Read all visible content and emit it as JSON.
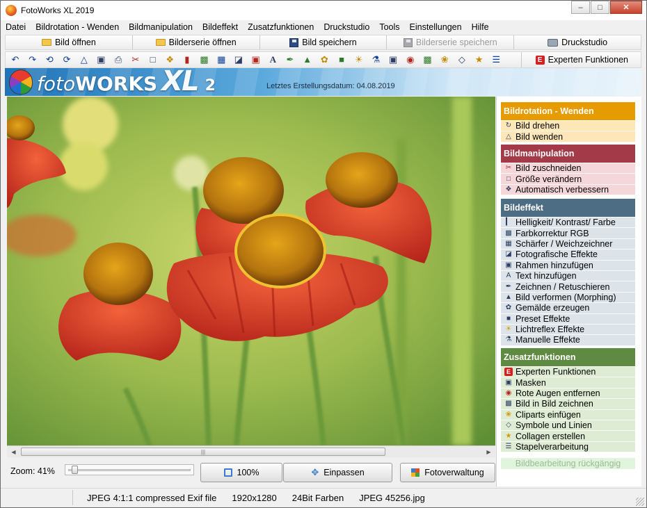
{
  "window": {
    "title": "FotoWorks XL 2019"
  },
  "menu": [
    "Datei",
    "Bildrotation - Wenden",
    "Bildmanipulation",
    "Bildeffekt",
    "Zusatzfunktionen",
    "Druckstudio",
    "Tools",
    "Einstellungen",
    "Hilfe"
  ],
  "actions": {
    "open": "Bild öffnen",
    "open_series": "Bilderserie öffnen",
    "save": "Bild speichern",
    "save_series": "Bilderserie speichern",
    "print_studio": "Druckstudio"
  },
  "toolbar": {
    "icons": [
      "rotate-left-icon",
      "rotate-right-icon",
      "rotate-ccw-icon",
      "rotate-cw-icon",
      "flip-icon",
      "box-icon",
      "printer-icon",
      "scissors-icon",
      "crop-icon",
      "magic-wand-icon",
      "levels-icon",
      "rgb-icon",
      "sharpen-icon",
      "effects-icon",
      "frame-icon",
      "text-icon",
      "brush-icon",
      "morph-icon",
      "paint-icon",
      "preset-icon",
      "light-icon",
      "manual-icon",
      "mask-icon",
      "red-eye-icon",
      "picture-in-picture-icon",
      "clipart-icon",
      "shapes-icon",
      "star-icon",
      "batch-icon"
    ],
    "expert_label": "Experten Funktionen",
    "expert_badge": "E"
  },
  "banner": {
    "logo_foto": "foto",
    "logo_works": "WORKS",
    "logo_xl": "XL",
    "logo_version": "2",
    "build_date": "Letztes Erstellungsdatum: 04.08.2019"
  },
  "bottom": {
    "zoom_label": "Zoom: 41%",
    "zoom_value": 0.05,
    "btn_100": "100%",
    "btn_fit": "Einpassen",
    "btn_manage": "Fotoverwaltung"
  },
  "sidebar": {
    "sections": [
      {
        "title": "Bildrotation - Wenden",
        "color": "#e69c00",
        "bg": "#fde7b8",
        "items": [
          {
            "label": "Bild drehen",
            "icon": "rotate-icon"
          },
          {
            "label": "Bild wenden",
            "icon": "flip-icon"
          }
        ]
      },
      {
        "title": "Bildmanipulation",
        "color": "#a33a48",
        "bg": "#f5d6d9",
        "items": [
          {
            "label": "Bild zuschneiden",
            "icon": "scissors-icon"
          },
          {
            "label": "Größe verändern",
            "icon": "resize-icon"
          },
          {
            "label": "Automatisch verbessern",
            "icon": "magic-wand-icon"
          }
        ]
      },
      {
        "title": "Bildeffekt",
        "color": "#4c6d84",
        "bg": "#dce4ea",
        "items": [
          {
            "label": "Helligkeit/ Kontrast/ Farbe",
            "icon": "levels-icon"
          },
          {
            "label": "Farbkorrektur RGB",
            "icon": "rgb-icon"
          },
          {
            "label": "Schärfer / Weichzeichner",
            "icon": "sharpen-icon"
          },
          {
            "label": "Fotografische Effekte",
            "icon": "photo-effects-icon"
          },
          {
            "label": "Rahmen hinzufügen",
            "icon": "frame-icon"
          },
          {
            "label": "Text hinzufügen",
            "icon": "text-icon"
          },
          {
            "label": "Zeichnen / Retuschieren",
            "icon": "brush-icon"
          },
          {
            "label": "Bild verformen (Morphing)",
            "icon": "morph-icon"
          },
          {
            "label": "Gemälde erzeugen",
            "icon": "paint-icon"
          },
          {
            "label": "Preset Effekte",
            "icon": "preset-icon"
          },
          {
            "label": "Lichtreflex Effekte",
            "icon": "light-icon"
          },
          {
            "label": "Manuelle Effekte",
            "icon": "manual-icon"
          }
        ]
      },
      {
        "title": "Zusatzfunktionen",
        "color": "#5f8a42",
        "bg": "#dfecd4",
        "items": [
          {
            "label": "Experten Funktionen",
            "icon": "expert-icon"
          },
          {
            "label": "Masken",
            "icon": "mask-icon"
          },
          {
            "label": "Rote Augen entfernen",
            "icon": "red-eye-icon"
          },
          {
            "label": "Bild in Bild zeichnen",
            "icon": "picture-in-picture-icon"
          },
          {
            "label": "Cliparts einfügen",
            "icon": "clipart-icon"
          },
          {
            "label": "Symbole und Linien",
            "icon": "shapes-icon"
          },
          {
            "label": "Collagen erstellen",
            "icon": "star-icon"
          },
          {
            "label": "Stapelverarbeitung",
            "icon": "batch-icon"
          }
        ]
      }
    ],
    "undo": "Bildbearbeitung rückgängig"
  },
  "status": {
    "format": "JPEG 4:1:1 compressed Exif file",
    "size": "1920x1280",
    "depth": "24Bit Farben",
    "file": "JPEG 45256.jpg"
  }
}
